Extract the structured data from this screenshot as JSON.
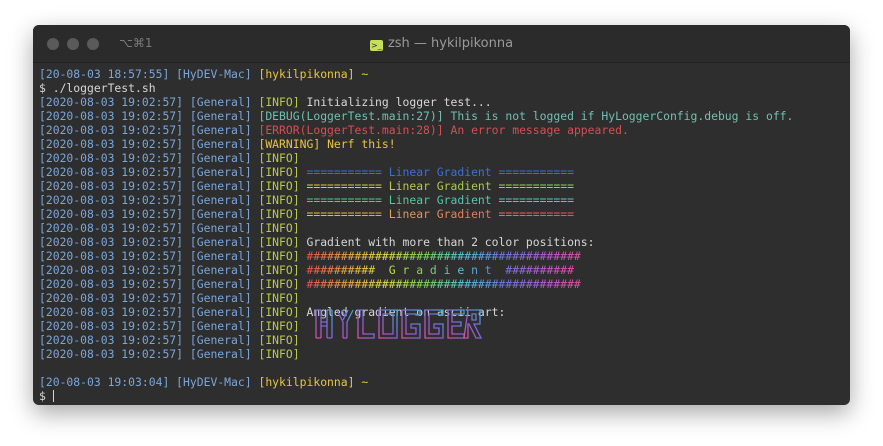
{
  "window": {
    "shortcut": "⌥⌘1",
    "title": "zsh — hykilpikonna",
    "icon": "terminal-icon"
  },
  "prompt1": {
    "time": "[20-08-03 18:57:55]",
    "host": "[HyDEV-Mac]",
    "user": "[hykilpikonna] ~"
  },
  "command": "$ ./loggerTest.sh",
  "ts": "[2020-08-03 19:02:57]",
  "category": "[General]",
  "lines": [
    {
      "level": "[INFO]",
      "text": "Initializing logger test..."
    },
    {
      "level": "[DEBUG(LoggerTest.main:27)]",
      "text": "This is not logged if HyLoggerConfig.debug is off."
    },
    {
      "level": "[ERROR(LoggerTest.main:28)]",
      "text": "An error message appeared."
    },
    {
      "level": "[WARNING]",
      "text": "Nerf this!"
    },
    {
      "level": "[INFO]",
      "text": ""
    },
    {
      "level": "[INFO]",
      "text": "=========== Linear Gradient ==========="
    },
    {
      "level": "[INFO]",
      "text": "=========== Linear Gradient ==========="
    },
    {
      "level": "[INFO]",
      "text": "=========== Linear Gradient ==========="
    },
    {
      "level": "[INFO]",
      "text": "=========== Linear Gradient ==========="
    },
    {
      "level": "[INFO]",
      "text": ""
    },
    {
      "level": "[INFO]",
      "text": "Gradient with more than 2 color positions:"
    },
    {
      "level": "[INFO]",
      "text": "########################################"
    },
    {
      "level": "[INFO]",
      "text": "##########  G r a d i e n t  ##########"
    },
    {
      "level": "[INFO]",
      "text": "########################################"
    },
    {
      "level": "[INFO]",
      "text": ""
    },
    {
      "level": "[INFO]",
      "text": "Angled gradient on ascii art:"
    },
    {
      "level": "[INFO]",
      "text": ""
    },
    {
      "level": "[INFO]",
      "text": ""
    },
    {
      "level": "[INFO]",
      "text": ""
    }
  ],
  "ascii_art": "HYLOGGER",
  "prompt2": {
    "time": "[20-08-03 19:03:04]",
    "host": "[HyDEV-Mac]",
    "user": "[hykilpikonna] ~"
  },
  "input_prompt": "$ ",
  "colors": {
    "gradient1": "#3b6fd6",
    "gradient2_a": "#e7c547",
    "gradient2_b": "#7ed957",
    "gradient3_a": "#4fd17a",
    "gradient3_b": "#56c7d8",
    "gradient4_a": "#e7c547",
    "gradient4_b": "#e94f6e"
  }
}
